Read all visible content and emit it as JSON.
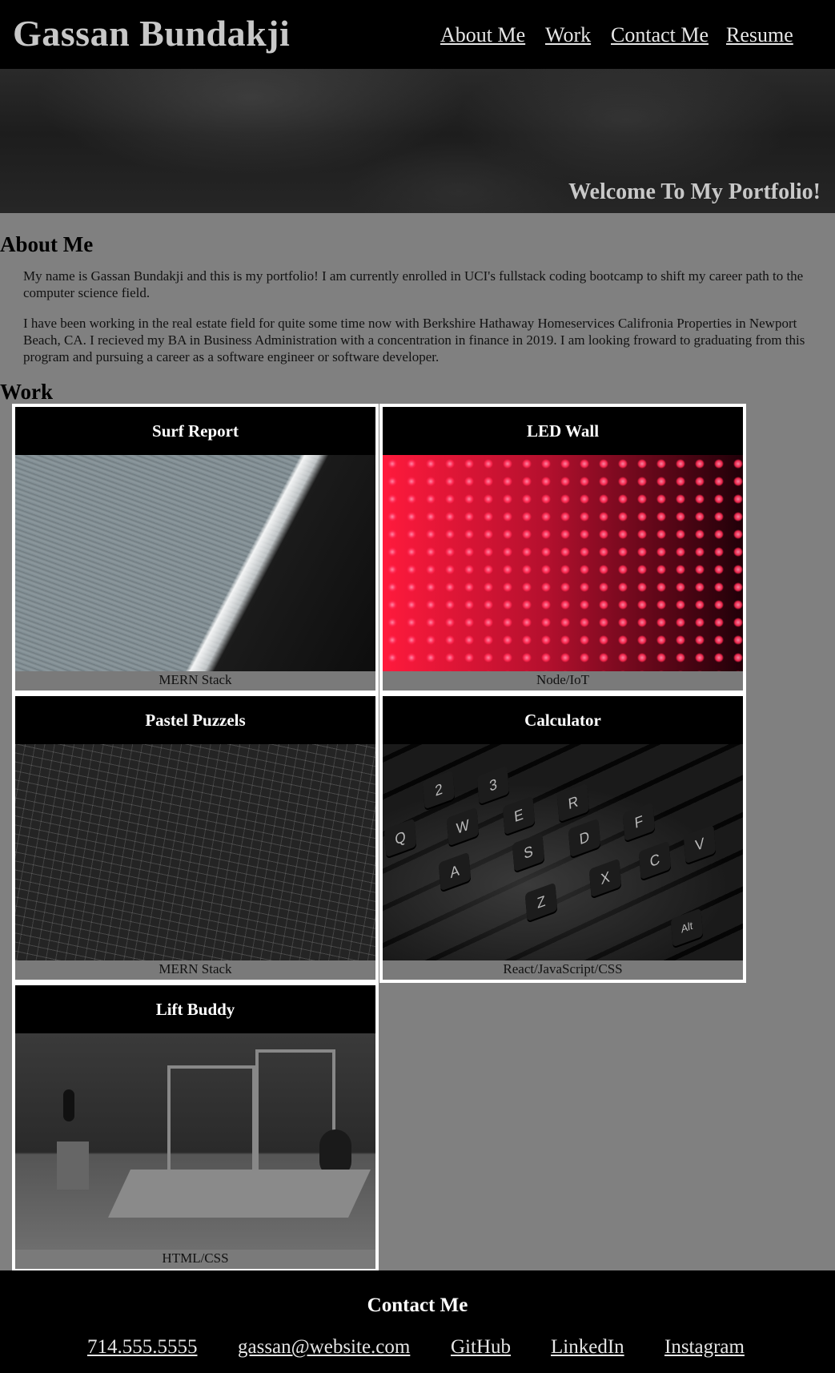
{
  "header": {
    "title": "Gassan Bundakji",
    "nav": [
      "About Me",
      "Work",
      "Contact Me",
      "Resume"
    ]
  },
  "hero": {
    "text": "Welcome To My Portfolio!"
  },
  "about": {
    "heading": "About Me",
    "paragraphs": [
      "My name is Gassan Bundakji and this is my portfolio! I am currently enrolled in UCI's fullstack coding bootcamp to shift my career path to the computer science field.",
      "I have been working in the real estate field for quite some time now with Berkshire Hathaway Homeservices Califronia Properties in Newport Beach, CA. I recieved my BA in Business Administration with a concentration in finance in 2019. I am looking froward to graduating from this program and pursuing a career as a software engineer or software developer."
    ]
  },
  "work": {
    "heading": "Work",
    "projects": [
      {
        "title": "Surf Report",
        "tech": "MERN Stack",
        "image": "beach-shoreline-photo"
      },
      {
        "title": "LED Wall",
        "tech": "Node/IoT",
        "image": "red-led-wall-photo"
      },
      {
        "title": "Pastel Puzzels",
        "tech": "MERN Stack",
        "image": "puzzle-pieces-photo"
      },
      {
        "title": "Calculator",
        "tech": "React/JavaScript/CSS",
        "image": "keyboard-photo"
      },
      {
        "title": "Lift Buddy",
        "tech": "HTML/CSS",
        "image": "gym-photo"
      }
    ]
  },
  "keyboard_keys": [
    "2",
    "3",
    "W",
    "E",
    "R",
    "Q",
    "A",
    "S",
    "D",
    "F",
    "Z",
    "X",
    "C",
    "V",
    "Alt"
  ],
  "footer": {
    "heading": "Contact Me",
    "links": [
      "714.555.5555",
      "gassan@website.com",
      "GitHub",
      "LinkedIn",
      "Instagram"
    ]
  },
  "colors": {
    "page_background": "#808080",
    "header_background": "#000000",
    "card_border": "#ffffff",
    "title_text": "#c8c8c8"
  }
}
